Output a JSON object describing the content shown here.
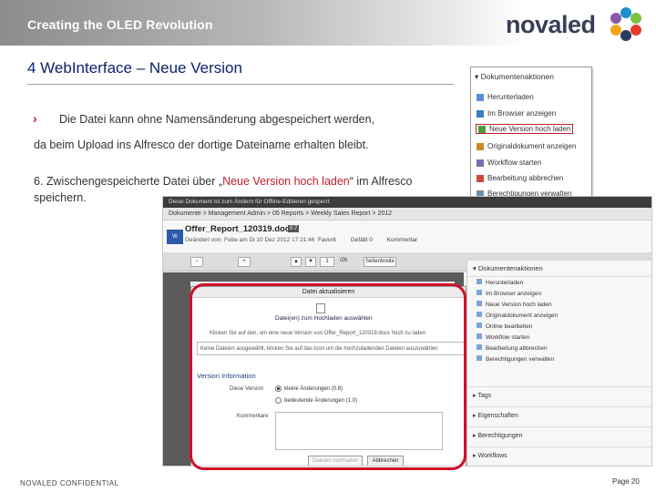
{
  "header": {
    "title": "Creating the OLED Revolution",
    "logo_text": "novaled"
  },
  "slide": {
    "title": "4 WebInterface – Neue Version",
    "bullet_text": "Die Datei kann ohne Namensänderung abgespeichert werden,",
    "continued_text": "da beim Upload ins Alfresco der dortige Dateiname erhalten bleibt.",
    "step_prefix": "6. Zwischengespeicherte Datei über „",
    "step_highlight": "Neue Version hoch laden",
    "step_suffix": "“ im Alfresco speichern."
  },
  "context_menu": {
    "header": "Dokumentenaktionen",
    "items": [
      "Herunterladen",
      "Im Browser anzeigen",
      "Neue Version hoch laden",
      "Originaldokument anzeigen",
      "Workflow starten",
      "Bearbeitung abbrechen",
      "Berechtigungen verwalten"
    ],
    "selected_index": 2
  },
  "screenshot": {
    "titlebar": "Diese Dokument ist zum Ändern für Offline-Editieren gesperrt",
    "breadcrumb": "Dokumente  >  Management Admin  >  05 Reports  >  Weekly Sales Report  >  2012",
    "doc_name": "Offer_Report_120319.docx",
    "doc_badge": "0.7",
    "doc_meta": "Geändert von: Febe am Di 10 Dez 2012 17:21:46",
    "actions": [
      "Favorit",
      "Gefällt 0",
      "Kommentar"
    ],
    "toolbar_page": "1",
    "toolbar_total": "/26",
    "toolbar_zoom": "Seitenbreite",
    "sidepanel": {
      "header": "Dokumentenaktionen",
      "items": [
        "Herunterladen",
        "Im Browser anzeigen",
        "Neue Version hoch laden",
        "Originaldokument anzeigen",
        "Online bearbeiten",
        "Workflow starten",
        "Bearbeitung abbrechen",
        "Berechtigungen verwalten"
      ],
      "sections": [
        "Tags",
        "Eigenschaften",
        "Berechtigungen",
        "Workflows"
      ]
    },
    "dialog": {
      "title": "Datei aktualisieren",
      "file_link": "Datei(en) zum Hochladen auswählen",
      "info": "Klicken Sie auf den, um eine neue Version von Offer_Report_120319.docx hoch zu laden",
      "input_hint": "Keine Dateien ausgewählt, klicken Sie auf das Icon um die hochzuladenden Dateien auszuwählen",
      "section": "Version Information",
      "version_label": "Diese Version",
      "option_minor": "kleine Änderungen (0.8)",
      "option_major": "bedeutende Änderungen (1.0)",
      "comments_label": "Kommentare",
      "upload_button": "Dateien hochladen",
      "cancel_button": "Abbrechen"
    }
  },
  "footer": {
    "confidential": "NOVALED CONFIDENTIAL",
    "page": "Page 20"
  },
  "colors": {
    "title_blue": "#0b1f6b",
    "accent_red": "#c0202a",
    "frame_red": "#d0102a"
  }
}
